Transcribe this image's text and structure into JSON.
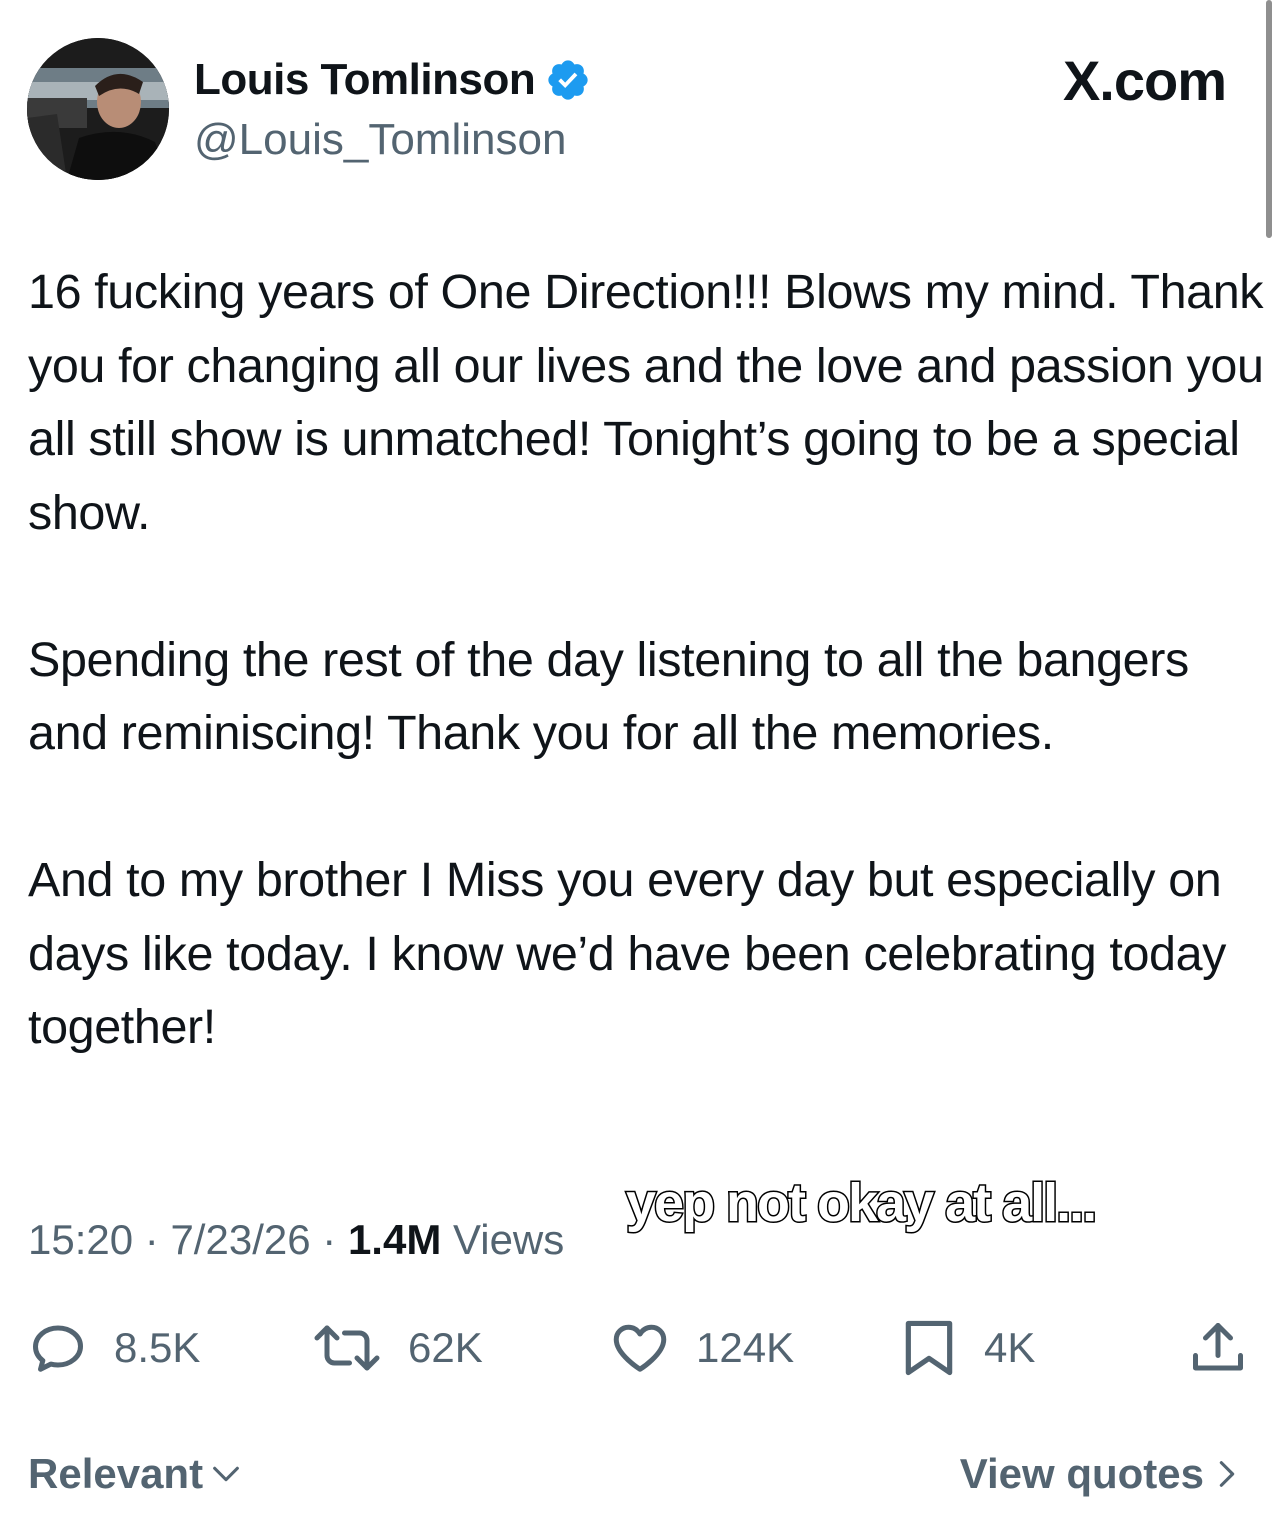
{
  "author": {
    "display_name": "Louis Tomlinson",
    "handle": "@Louis_Tomlinson",
    "verified": true
  },
  "brand": "X.com",
  "tweet": {
    "paragraphs": [
      "16 fucking years of One Direction!!! Blows my mind. Thank you for changing all our lives and the love and passion you all still show is unmatched! Tonight’s going to be a special show.",
      "Spending the rest of the day listening to all the bangers and reminiscing! Thank you for all the memories.",
      "And to my brother I Miss you every day but especially on days like today. I know we’d have been celebrating today together!"
    ],
    "time": "15:20",
    "date": "7/23/26",
    "separator": "·",
    "views_count": "1.4M",
    "views_label": "Views"
  },
  "overlay_caption": "yep not okay at all...",
  "actions": {
    "replies": "8.5K",
    "reposts": "62K",
    "likes": "124K",
    "bookmarks": "4K"
  },
  "footer": {
    "sort_label": "Relevant",
    "view_quotes_label": "View quotes"
  },
  "icons": {
    "verified": "verified-badge-icon",
    "reply": "reply-icon",
    "repost": "repost-icon",
    "like": "heart-icon",
    "bookmark": "bookmark-icon",
    "share": "share-icon"
  },
  "colors": {
    "verified_blue": "#1d9bf0",
    "secondary_text": "#536471",
    "primary_text": "#0f1419"
  }
}
